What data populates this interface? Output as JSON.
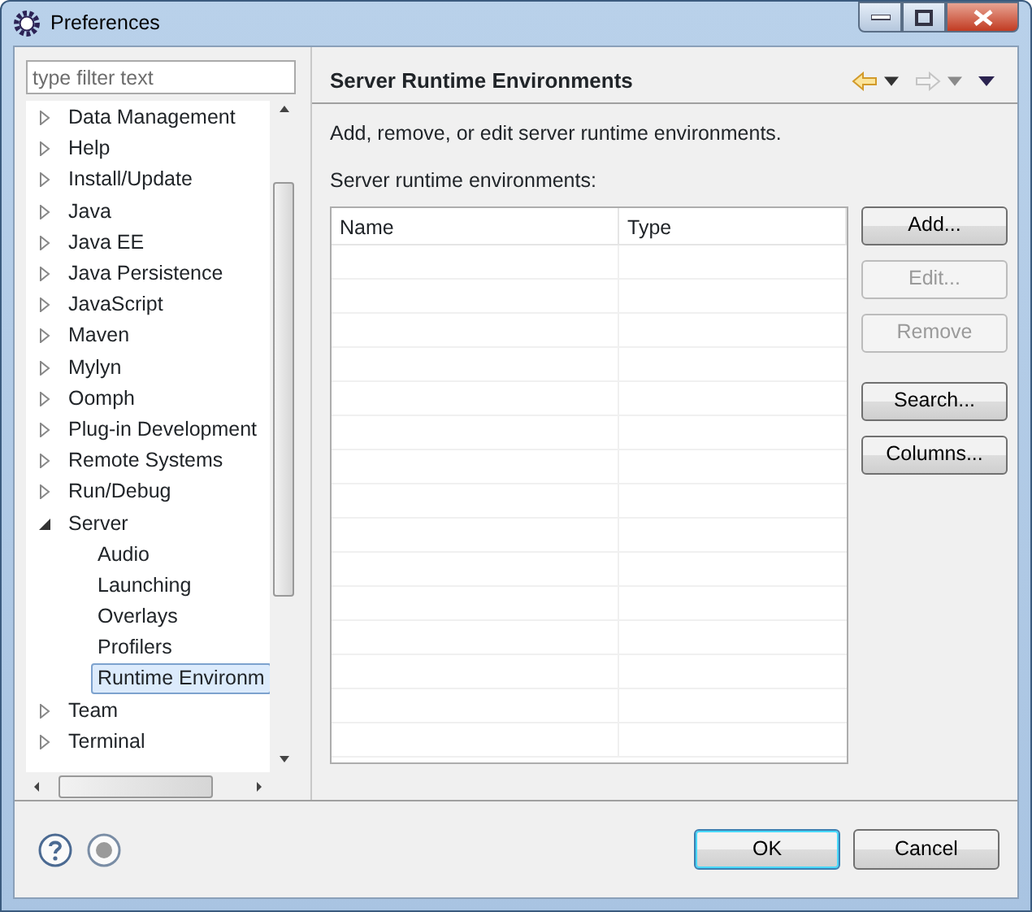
{
  "window": {
    "title": "Preferences"
  },
  "filter": {
    "placeholder": "type filter text"
  },
  "tree": [
    {
      "label": "Data Management",
      "expanded": false
    },
    {
      "label": "Help",
      "expanded": false
    },
    {
      "label": "Install/Update",
      "expanded": false
    },
    {
      "label": "Java",
      "expanded": false
    },
    {
      "label": "Java EE",
      "expanded": false
    },
    {
      "label": "Java Persistence",
      "expanded": false
    },
    {
      "label": "JavaScript",
      "expanded": false
    },
    {
      "label": "Maven",
      "expanded": false
    },
    {
      "label": "Mylyn",
      "expanded": false
    },
    {
      "label": "Oomph",
      "expanded": false
    },
    {
      "label": "Plug-in Development",
      "expanded": false
    },
    {
      "label": "Remote Systems",
      "expanded": false
    },
    {
      "label": "Run/Debug",
      "expanded": false
    },
    {
      "label": "Server",
      "expanded": true,
      "children": [
        {
          "label": "Audio",
          "selected": false
        },
        {
          "label": "Launching",
          "selected": false
        },
        {
          "label": "Overlays",
          "selected": false
        },
        {
          "label": "Profilers",
          "selected": false
        },
        {
          "label": "Runtime Environm",
          "selected": true
        }
      ]
    },
    {
      "label": "Team",
      "expanded": false
    },
    {
      "label": "Terminal",
      "expanded": false
    }
  ],
  "page": {
    "title": "Server Runtime Environments",
    "nav": [
      {
        "kind": "back",
        "disabled": false
      },
      {
        "kind": "forward",
        "disabled": true
      }
    ],
    "description": "Add, remove, or edit server runtime environments.",
    "list_label": "Server runtime environments:",
    "table": {
      "columns": [
        "Name",
        "Type"
      ]
    },
    "buttons": [
      {
        "label": "Add...",
        "disabled": false
      },
      {
        "label": "Edit...",
        "disabled": true
      },
      {
        "label": "Remove",
        "disabled": true
      },
      {
        "label": "Search...",
        "disabled": false
      },
      {
        "label": "Columns...",
        "disabled": false
      }
    ]
  },
  "footer": {
    "buttons": [
      {
        "label": "OK",
        "default": true
      },
      {
        "label": "Cancel",
        "default": false
      }
    ]
  }
}
